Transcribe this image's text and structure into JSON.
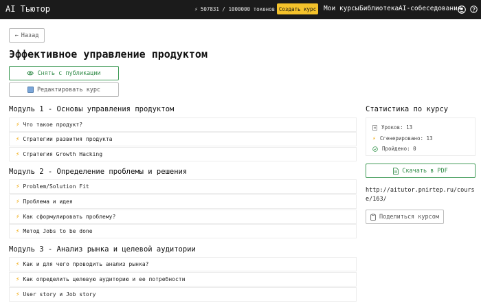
{
  "header": {
    "brand": "AI Тьютор",
    "tokens": "507831 / 1000000 токенов",
    "create_course": "Создать курс",
    "nav_my_courses": "Мои курсы",
    "nav_library": "Библиотека",
    "nav_ai_interview": "AI-собеседования"
  },
  "actions": {
    "back": "Назад",
    "unpublish": "Снять с публикации",
    "edit": "Редактировать курс"
  },
  "course": {
    "title": "Эффективное управление продуктом"
  },
  "modules": [
    {
      "title": "Модуль 1 - Основы управления продуктом",
      "lessons": [
        "Что такое продукт?",
        "Стратегии развития продукта",
        "Стратегия Growth Hacking"
      ]
    },
    {
      "title": "Модуль 2 - Определение проблемы и решения",
      "lessons": [
        "Problem/Solution Fit",
        "Проблема и идея",
        "Как сформулировать проблему?",
        "Метод Jobs to be done"
      ]
    },
    {
      "title": "Модуль 3 - Анализ рынка и целевой аудитории",
      "lessons": [
        "Как и для чего проводить анализ рынка?",
        "Как определить целевую аудиторию и ее потребности",
        "User story и Job story"
      ]
    }
  ],
  "stats": {
    "title": "Статистика по курсу",
    "lessons": "Уроков: 13",
    "generated": "Сгенерировано: 13",
    "completed": "Пройдено: 0"
  },
  "download_pdf": "Скачать в PDF",
  "course_url": "http://aitutor.pnirtep.ru/course/163/",
  "share": "Поделиться курсом",
  "colors": {
    "topbar": "#1b1b1b",
    "accent_yellow": "#f4c22b",
    "accent_green": "#2f8a46",
    "bolt": "#f0a500"
  },
  "icons": {
    "token": "bolt-icon",
    "user": "user-circle-icon",
    "help": "question-circle-icon",
    "back": "arrow-left-icon",
    "unpublish": "eye-icon",
    "edit": "edit-emoji-icon",
    "lesson": "bolt-icon",
    "stat_lessons": "document-icon",
    "stat_generated": "bolt-icon",
    "stat_completed": "check-circle-icon",
    "pdf": "file-icon",
    "share": "clipboard-icon"
  }
}
